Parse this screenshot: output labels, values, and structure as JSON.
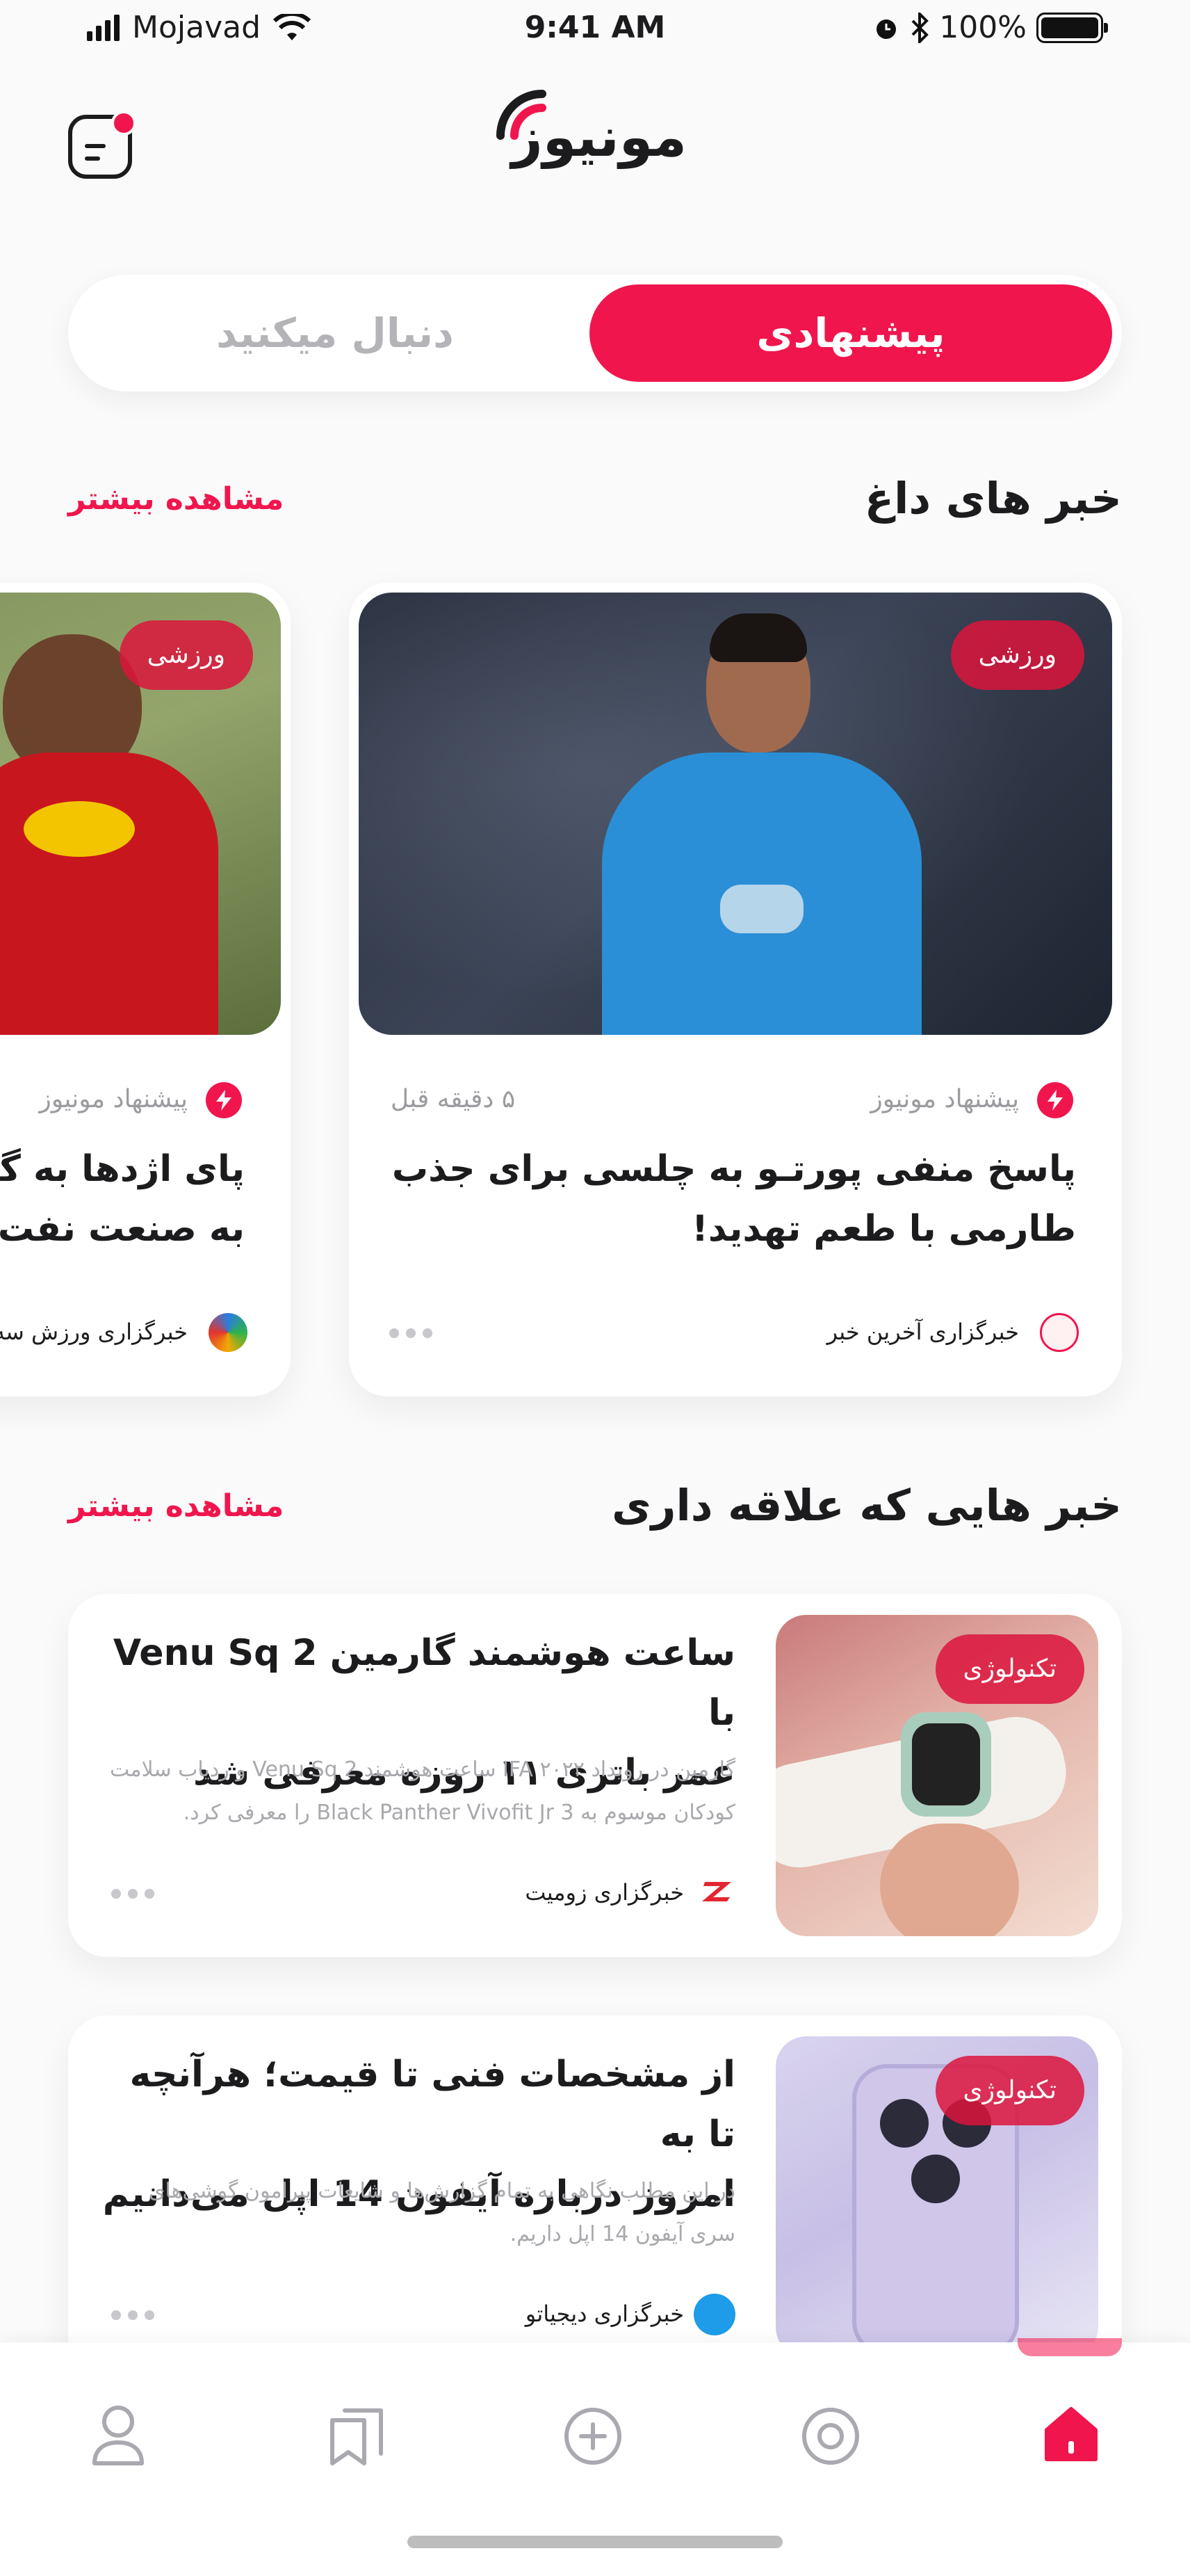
{
  "status_bar": {
    "carrier": "Mojavad",
    "time": "9:41 AM",
    "battery": "100%"
  },
  "header": {
    "logo_text": "مونیوز"
  },
  "tabs": {
    "active": "پیشنهادی",
    "inactive": "دنبال میکنید"
  },
  "hot_news": {
    "title": "خبر های داغ",
    "see_more": "مشاهده بیشتر",
    "cards": [
      {
        "badge": "ورزشی",
        "suggested": "پیشنهاد مونیوز",
        "time": "۵ دقیقه قبل",
        "headline_line1": "پاسخ منفی پورتـو به چلسی برای جذب",
        "headline_line2": "طارمی با طعم تهدید!",
        "source": "خبرگزاری آخرین خبر"
      },
      {
        "badge": "ورزشی",
        "suggested": "پیشنهاد مونیوز",
        "headline_line1": "پای اژدها به گلزنی",
        "headline_line2": "به صنعت نفت آ",
        "source": "خبرگزاری ورزش سه"
      }
    ]
  },
  "interest_news": {
    "title": "خبر هایی که علاقه داری",
    "see_more": "مشاهده بیشتر",
    "items": [
      {
        "badge": "تکنولوژی",
        "headline_line1": "ساعت هوشمند گارمین Venu Sq 2 با",
        "headline_line2": "عمر باتری ۱۱ روزه معرفی شد",
        "desc_line1": "گارمین در رویداد IFA ۲۰۲۲ ساعت هوشمند Venu Sq 2 و ردیاب سلامت",
        "desc_line2": "کودکان موسوم به Black Panther Vivofit Jr 3 را معرفی کرد.",
        "source": "خبرگزاری زومیت"
      },
      {
        "badge": "تکنولوژی",
        "headline_line1": "از مشخصات فنی تا قیمت؛ هرآنچه تا به",
        "headline_line2": "امروز درباره آیفون 14 اپل می‌دانیم",
        "desc_line1": "در این مطلب نگاهی به تمام گزارش‌ها و شایعات پیرامون گوشی‌های",
        "desc_line2": "سری آیفون 14 اپل داریم.",
        "source": "خبرگزاری دیجیاتو"
      }
    ]
  },
  "nav": {
    "items": [
      "home-icon",
      "compass-icon",
      "add-icon",
      "bookmarks-icon",
      "profile-icon"
    ],
    "accent": "#f0164d"
  }
}
